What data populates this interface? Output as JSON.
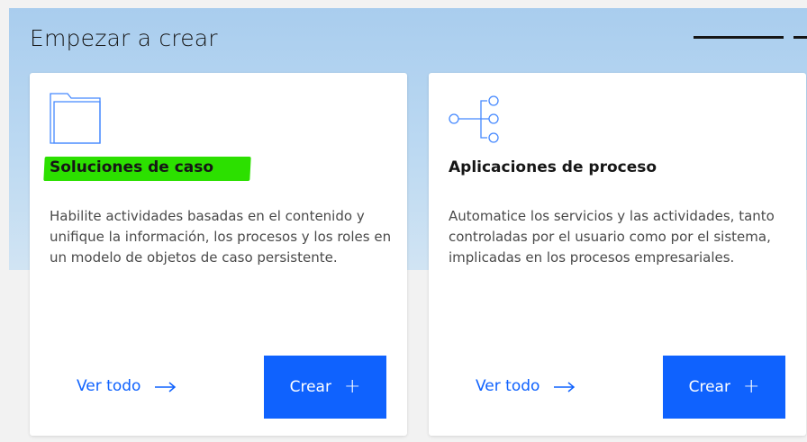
{
  "page": {
    "title": "Empezar a crear"
  },
  "cards": [
    {
      "icon": "folder-icon",
      "title": "Soluciones de caso",
      "description": "Habilite actividades basadas en el contenido y unifique la información, los procesos y los roles en un modelo de objetos de caso persistente.",
      "view_all_label": "Ver todo",
      "create_label": "Crear",
      "highlighted": true
    },
    {
      "icon": "process-tree-icon",
      "title": "Aplicaciones de proceso",
      "description": "Automatice los servicios y las actividades, tanto controladas por el usuario como por el sistema, implicadas en los procesos empresariales.",
      "view_all_label": "Ver todo",
      "create_label": "Crear",
      "highlighted": false
    }
  ],
  "colors": {
    "accent": "#0f62fe",
    "highlight": "#2ce000",
    "banner": "#a9cdee",
    "icon_stroke": "#4589ff"
  }
}
